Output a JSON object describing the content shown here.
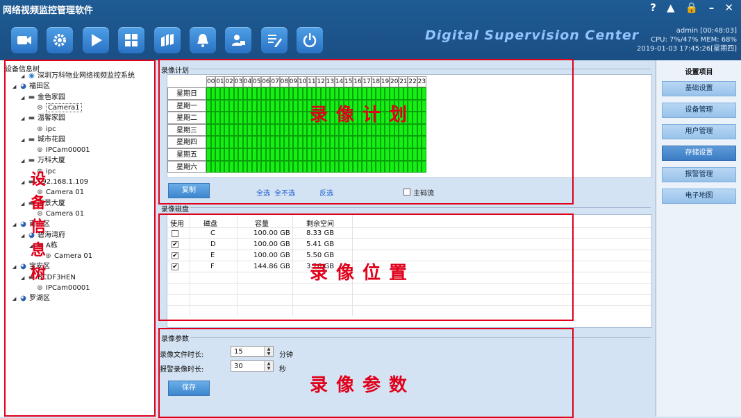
{
  "app": {
    "title": "网络视频监控管理软件",
    "window_controls": "? ▲ 🔒 – ✕",
    "banner": "Digital Supervision Center",
    "user_line": "admin   [00:48:03]",
    "cpu_mem": "CPU: 7%/47%  MEM: 68%",
    "datetime": "2019-01-03 17:45:26[星期四]"
  },
  "toolbar": [
    "camera-icon",
    "gear-icon",
    "play-icon",
    "grid-icon",
    "map-icon",
    "bell-icon",
    "user-group-icon",
    "edit-icon",
    "power-icon"
  ],
  "tree": {
    "title": "设备信息树",
    "nodes": [
      {
        "label": "深圳万科物业网络视频监控系统",
        "type": "sys"
      },
      {
        "label": "福田区",
        "type": "area"
      },
      {
        "label": "金色家园",
        "type": "dvr"
      },
      {
        "label": "Camera1",
        "type": "cam"
      },
      {
        "label": "温馨家园",
        "type": "dvr"
      },
      {
        "label": "ipc",
        "type": "cam"
      },
      {
        "label": "城市花园",
        "type": "dvr"
      },
      {
        "label": "IPCam00001",
        "type": "cam"
      },
      {
        "label": "万科大厦",
        "type": "dvr"
      },
      {
        "label": "ipc",
        "type": "cam"
      },
      {
        "label": "192.168.1.109",
        "type": "dvr"
      },
      {
        "label": "Camera 01",
        "type": "cam"
      },
      {
        "label": "海景大厦",
        "type": "dvr"
      },
      {
        "label": "Camera 01",
        "type": "cam"
      },
      {
        "label": "南山区",
        "type": "area"
      },
      {
        "label": "碧海湾府",
        "type": "area"
      },
      {
        "label": "A栋",
        "type": "dvr"
      },
      {
        "label": "Camera 01",
        "type": "cam"
      },
      {
        "label": "宝安区",
        "type": "area"
      },
      {
        "label": "BCDF3HEN",
        "type": "dvr"
      },
      {
        "label": "IPCam00001",
        "type": "cam"
      },
      {
        "label": "罗湖区",
        "type": "area"
      }
    ]
  },
  "overlays": {
    "tree_chars": [
      "设",
      "备",
      "信",
      "息",
      "树"
    ],
    "schedule": "录像计划",
    "disk": "录像位置",
    "params": "录像参数"
  },
  "schedule": {
    "section_title": "录像计划",
    "hours": [
      "00",
      "01",
      "02",
      "03",
      "04",
      "05",
      "06",
      "07",
      "08",
      "09",
      "10",
      "11",
      "12",
      "13",
      "14",
      "15",
      "16",
      "17",
      "18",
      "19",
      "20",
      "21",
      "22",
      "23"
    ],
    "days": [
      "星期日",
      "星期一",
      "星期二",
      "星期三",
      "星期四",
      "星期五",
      "星期六"
    ],
    "copy_label": "复制",
    "select_all": "全选",
    "select_none": "全不选",
    "invert": "反选",
    "main_stream_label": "主码流"
  },
  "disk": {
    "section_title": "录像磁盘",
    "headers": [
      "使用",
      "磁盘",
      "容量",
      "剩余空间"
    ],
    "rows": [
      {
        "used": false,
        "disk": "C",
        "capacity": "100.00 GB",
        "free": "8.33 GB"
      },
      {
        "used": true,
        "disk": "D",
        "capacity": "100.00 GB",
        "free": "5.41 GB"
      },
      {
        "used": true,
        "disk": "E",
        "capacity": "100.00 GB",
        "free": "5.50 GB"
      },
      {
        "used": true,
        "disk": "F",
        "capacity": "144.86 GB",
        "free": "3.26 GB"
      }
    ]
  },
  "params": {
    "section_title": "录像参数",
    "file_duration_label": "录像文件时长:",
    "file_duration_value": "15",
    "file_duration_unit": "分钟",
    "alarm_duration_label": "报警录像时长:",
    "alarm_duration_value": "30",
    "alarm_duration_unit": "秒",
    "save_label": "保存"
  },
  "settings": {
    "title": "设置项目",
    "items": [
      "基础设置",
      "设备管理",
      "用户管理",
      "存储设置",
      "报警管理",
      "电子地图"
    ],
    "active_index": 3
  },
  "colors": {
    "schedule_fill": "#14f014",
    "accent_red": "#e0001a",
    "header_blue": "#1a4f84"
  }
}
